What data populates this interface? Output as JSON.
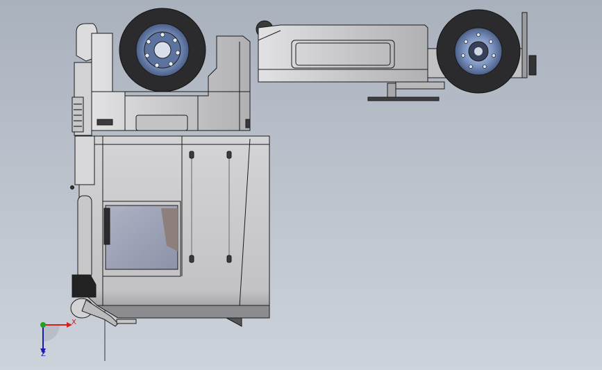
{
  "viewport": {
    "background_top": "#a9b1bd",
    "background_bottom": "#cdd3db"
  },
  "model": {
    "body_color": "#c9c9cb",
    "body_dark": "#a5a5a8",
    "edge_color": "#1a1a1a",
    "tire_color": "#2b2b2d",
    "rim_color": "#6f88b6",
    "window_color": "#9da3b8"
  },
  "triad": {
    "x_label": "X",
    "z_label": "Z",
    "x_color": "#d42020",
    "y_color": "#1fa21f",
    "z_color": "#1b1bb0"
  }
}
